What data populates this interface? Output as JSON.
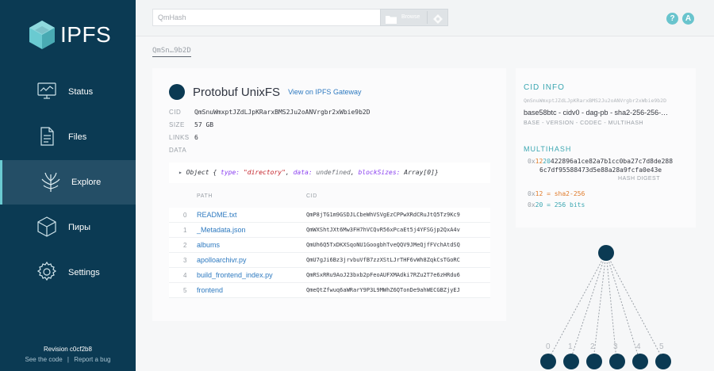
{
  "app": {
    "logo_text": "IPFS",
    "brand_color": "#0b3a53",
    "accent_color": "#69c4cd"
  },
  "sidebar": {
    "items": [
      {
        "label": "Status",
        "icon": "monitor-icon",
        "active": false
      },
      {
        "label": "Files",
        "icon": "document-icon",
        "active": false
      },
      {
        "label": "Explore",
        "icon": "tree-icon",
        "active": true
      },
      {
        "label": "Пиры",
        "icon": "cube-icon",
        "active": false
      },
      {
        "label": "Settings",
        "icon": "gear-icon",
        "active": false
      }
    ],
    "revision": "Revision c0cf2b8",
    "see_code": "See the code",
    "separator": "|",
    "report_bug": "Report a bug"
  },
  "topbar": {
    "search_placeholder": "QmHash",
    "browse_label": "Browse",
    "help_glyph": "?",
    "lang_glyph": "A"
  },
  "breadcrumb": "QmSn…9b2D",
  "node": {
    "codec_name": "Protobuf",
    "codec_kind": "UnixFS",
    "gateway_link": "View on IPFS Gateway",
    "meta": [
      {
        "key": "CID",
        "value": "QmSnuWmxptJZdLJpKRarxBMS2Ju2oANVrgbr2xWbie9b2D"
      },
      {
        "key": "SIZE",
        "value": "57 GB"
      },
      {
        "key": "LINKS",
        "value": "6"
      },
      {
        "key": "DATA",
        "value": ""
      }
    ],
    "object_preview": {
      "arrow": "▸",
      "prefix": "Object {",
      "type_key": "type:",
      "type_val": "\"directory\"",
      "data_key": "data:",
      "data_val": "undefined",
      "block_key": "blockSizes:",
      "block_val": "Array[0]",
      "suffix": "}"
    }
  },
  "links_table": {
    "headers": {
      "path": "PATH",
      "cid": "CID"
    },
    "rows": [
      {
        "index": "0",
        "path": "README.txt",
        "cid": "QmP8jTG1m9GSDJLCbeWhVSVgEzCPPwXRdCRuJtQ5Tz9Kc9"
      },
      {
        "index": "1",
        "path": "_Metadata.json",
        "cid": "QmWXShtJXt6Mw3FH7hVCQvR56xPcaEt5j4YFSGjp2QxA4v"
      },
      {
        "index": "2",
        "path": "albums",
        "cid": "QmUh6Q5TxDKXSqoNU1GoogbhTveQQV9JMeQjfFVchAtdSQ"
      },
      {
        "index": "3",
        "path": "apolloarchivr.py",
        "cid": "QmU7gJi6Bz3jrvbuVfB7zzXStLJrTHF6vWh8ZqkCsTGoRC"
      },
      {
        "index": "4",
        "path": "build_frontend_index.py",
        "cid": "QmRSxRRu9AoJ23bxb2pFeoAUFXMAdki7RZu2T7e6zHRdu6"
      },
      {
        "index": "5",
        "path": "frontend",
        "cid": "QmeQtZfwuq6aWRarY9P3L9MWhZ6QTonDe9ahWECGBZjyEJ"
      }
    ]
  },
  "cid_info": {
    "title": "CID INFO",
    "cid": "QmSnuWmxptJZdLJpKRarxBMS2Ju2oANVrgbr2xWbie9b2D",
    "human": "base58btc - cidv0 - dag-pb - sha2-256-256-…",
    "caption": "BASE - VERSION - CODEC - MULTIHASH",
    "multihash_title": "MULTIHASH",
    "mh_prefix": "0x",
    "mh_fn_code": "12",
    "mh_len_code": "20",
    "mh_digest_line1": "422896a1ce82a7b1cc0ba27c7d8de288",
    "mh_digest_line2": "6c7df95588473d5e88a28a9fcfa0e43e",
    "digest_caption": "HASH DIGEST",
    "fn_line_prefix": "0x",
    "fn_line_code": "12",
    "fn_line_eq": " = ",
    "fn_line_name": "sha2-256",
    "len_line_prefix": "0x",
    "len_line_code": "20",
    "len_line_eq": " = ",
    "len_line_value": "256 bits"
  },
  "graph": {
    "labels": [
      "0",
      "1",
      "2",
      "3",
      "4",
      "5"
    ]
  }
}
